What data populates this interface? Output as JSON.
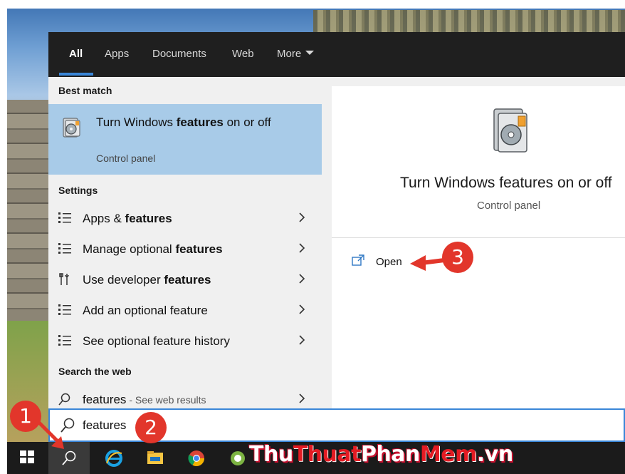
{
  "tabs": [
    {
      "label": "All",
      "active": true
    },
    {
      "label": "Apps"
    },
    {
      "label": "Documents"
    },
    {
      "label": "Web"
    },
    {
      "label": "More"
    }
  ],
  "best_match": {
    "header": "Best match",
    "title_pre": "Turn Windows ",
    "title_bold": "features",
    "title_post": " on or off",
    "subtitle": "Control panel",
    "icon": "windows-features-icon"
  },
  "settings": {
    "header": "Settings",
    "items": [
      {
        "pre": "Apps & ",
        "bold": "features",
        "post": "",
        "icon": "list-icon"
      },
      {
        "pre": "Manage optional ",
        "bold": "features",
        "post": "",
        "icon": "list-icon"
      },
      {
        "pre": "Use developer ",
        "bold": "features",
        "post": "",
        "icon": "developer-tools-icon"
      },
      {
        "pre": "Add an optional feature",
        "bold": "",
        "post": "",
        "icon": "list-icon"
      },
      {
        "pre": "See optional feature history",
        "bold": "",
        "post": "",
        "icon": "list-icon"
      }
    ]
  },
  "web": {
    "header": "Search the web",
    "query": "features",
    "suffix": " - See web results"
  },
  "preview": {
    "title": "Turn Windows features on or off",
    "subtitle": "Control panel",
    "open_label": "Open"
  },
  "search": {
    "value": "features"
  },
  "badges": [
    "1",
    "2",
    "3"
  ],
  "watermark": {
    "part1": "Thu",
    "part2": "Thuat",
    "part3": "Phan",
    "part4": "Mem",
    "part5": ".vn"
  },
  "colors": {
    "accent": "#3a86d8",
    "selection": "#a8cbe8",
    "badge": "#e2362b"
  }
}
